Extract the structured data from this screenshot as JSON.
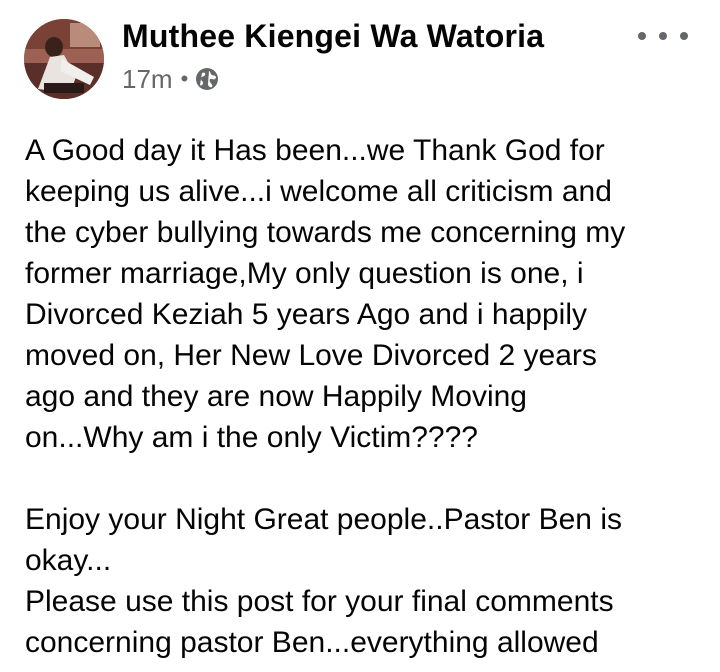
{
  "post": {
    "author": {
      "name": "Muthee Kiengei Wa Watoria",
      "avatar_icon": "profile-avatar"
    },
    "timestamp": "17m",
    "separator": "•",
    "privacy_icon": "globe-icon",
    "more_icon": "more-options-icon",
    "body": {
      "paragraph_1": [
        "A Good day it Has been...we Thank God for",
        "keeping us alive...i welcome all criticism and",
        "the cyber bullying towards me concerning my",
        "former marriage,My only question is one, i",
        "Divorced Keziah 5 years Ago and i happily",
        "moved on, Her New Love Divorced 2 years",
        "ago and they are now Happily Moving",
        "on...Why am i the only Victim????"
      ],
      "paragraph_2": [
        "Enjoy your Night Great people..Pastor Ben is",
        "okay...",
        "Please use this post for your final comments",
        "concerning pastor Ben...everything allowed"
      ]
    }
  },
  "colors": {
    "text_primary": "#050505",
    "text_secondary": "#65676b",
    "background": "#ffffff"
  }
}
